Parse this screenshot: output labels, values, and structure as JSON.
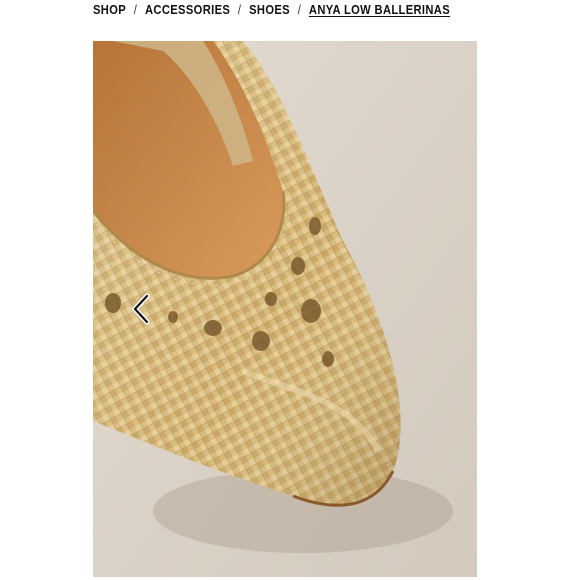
{
  "breadcrumb": {
    "items": [
      {
        "label": "SHOP"
      },
      {
        "label": "ACCESSORIES"
      },
      {
        "label": "SHOES"
      },
      {
        "label": "ANYA LOW BALLERINAS"
      }
    ],
    "separator": "/"
  },
  "gallery": {
    "image_subject": "gold woven leather ballerina flat",
    "prev_icon": "chevron-left-icon"
  },
  "colors": {
    "background": "#ffffff",
    "text": "#111111",
    "backdrop": "#ddd5cb",
    "gold": "#d6b77c",
    "lining": "#c98a4e"
  }
}
